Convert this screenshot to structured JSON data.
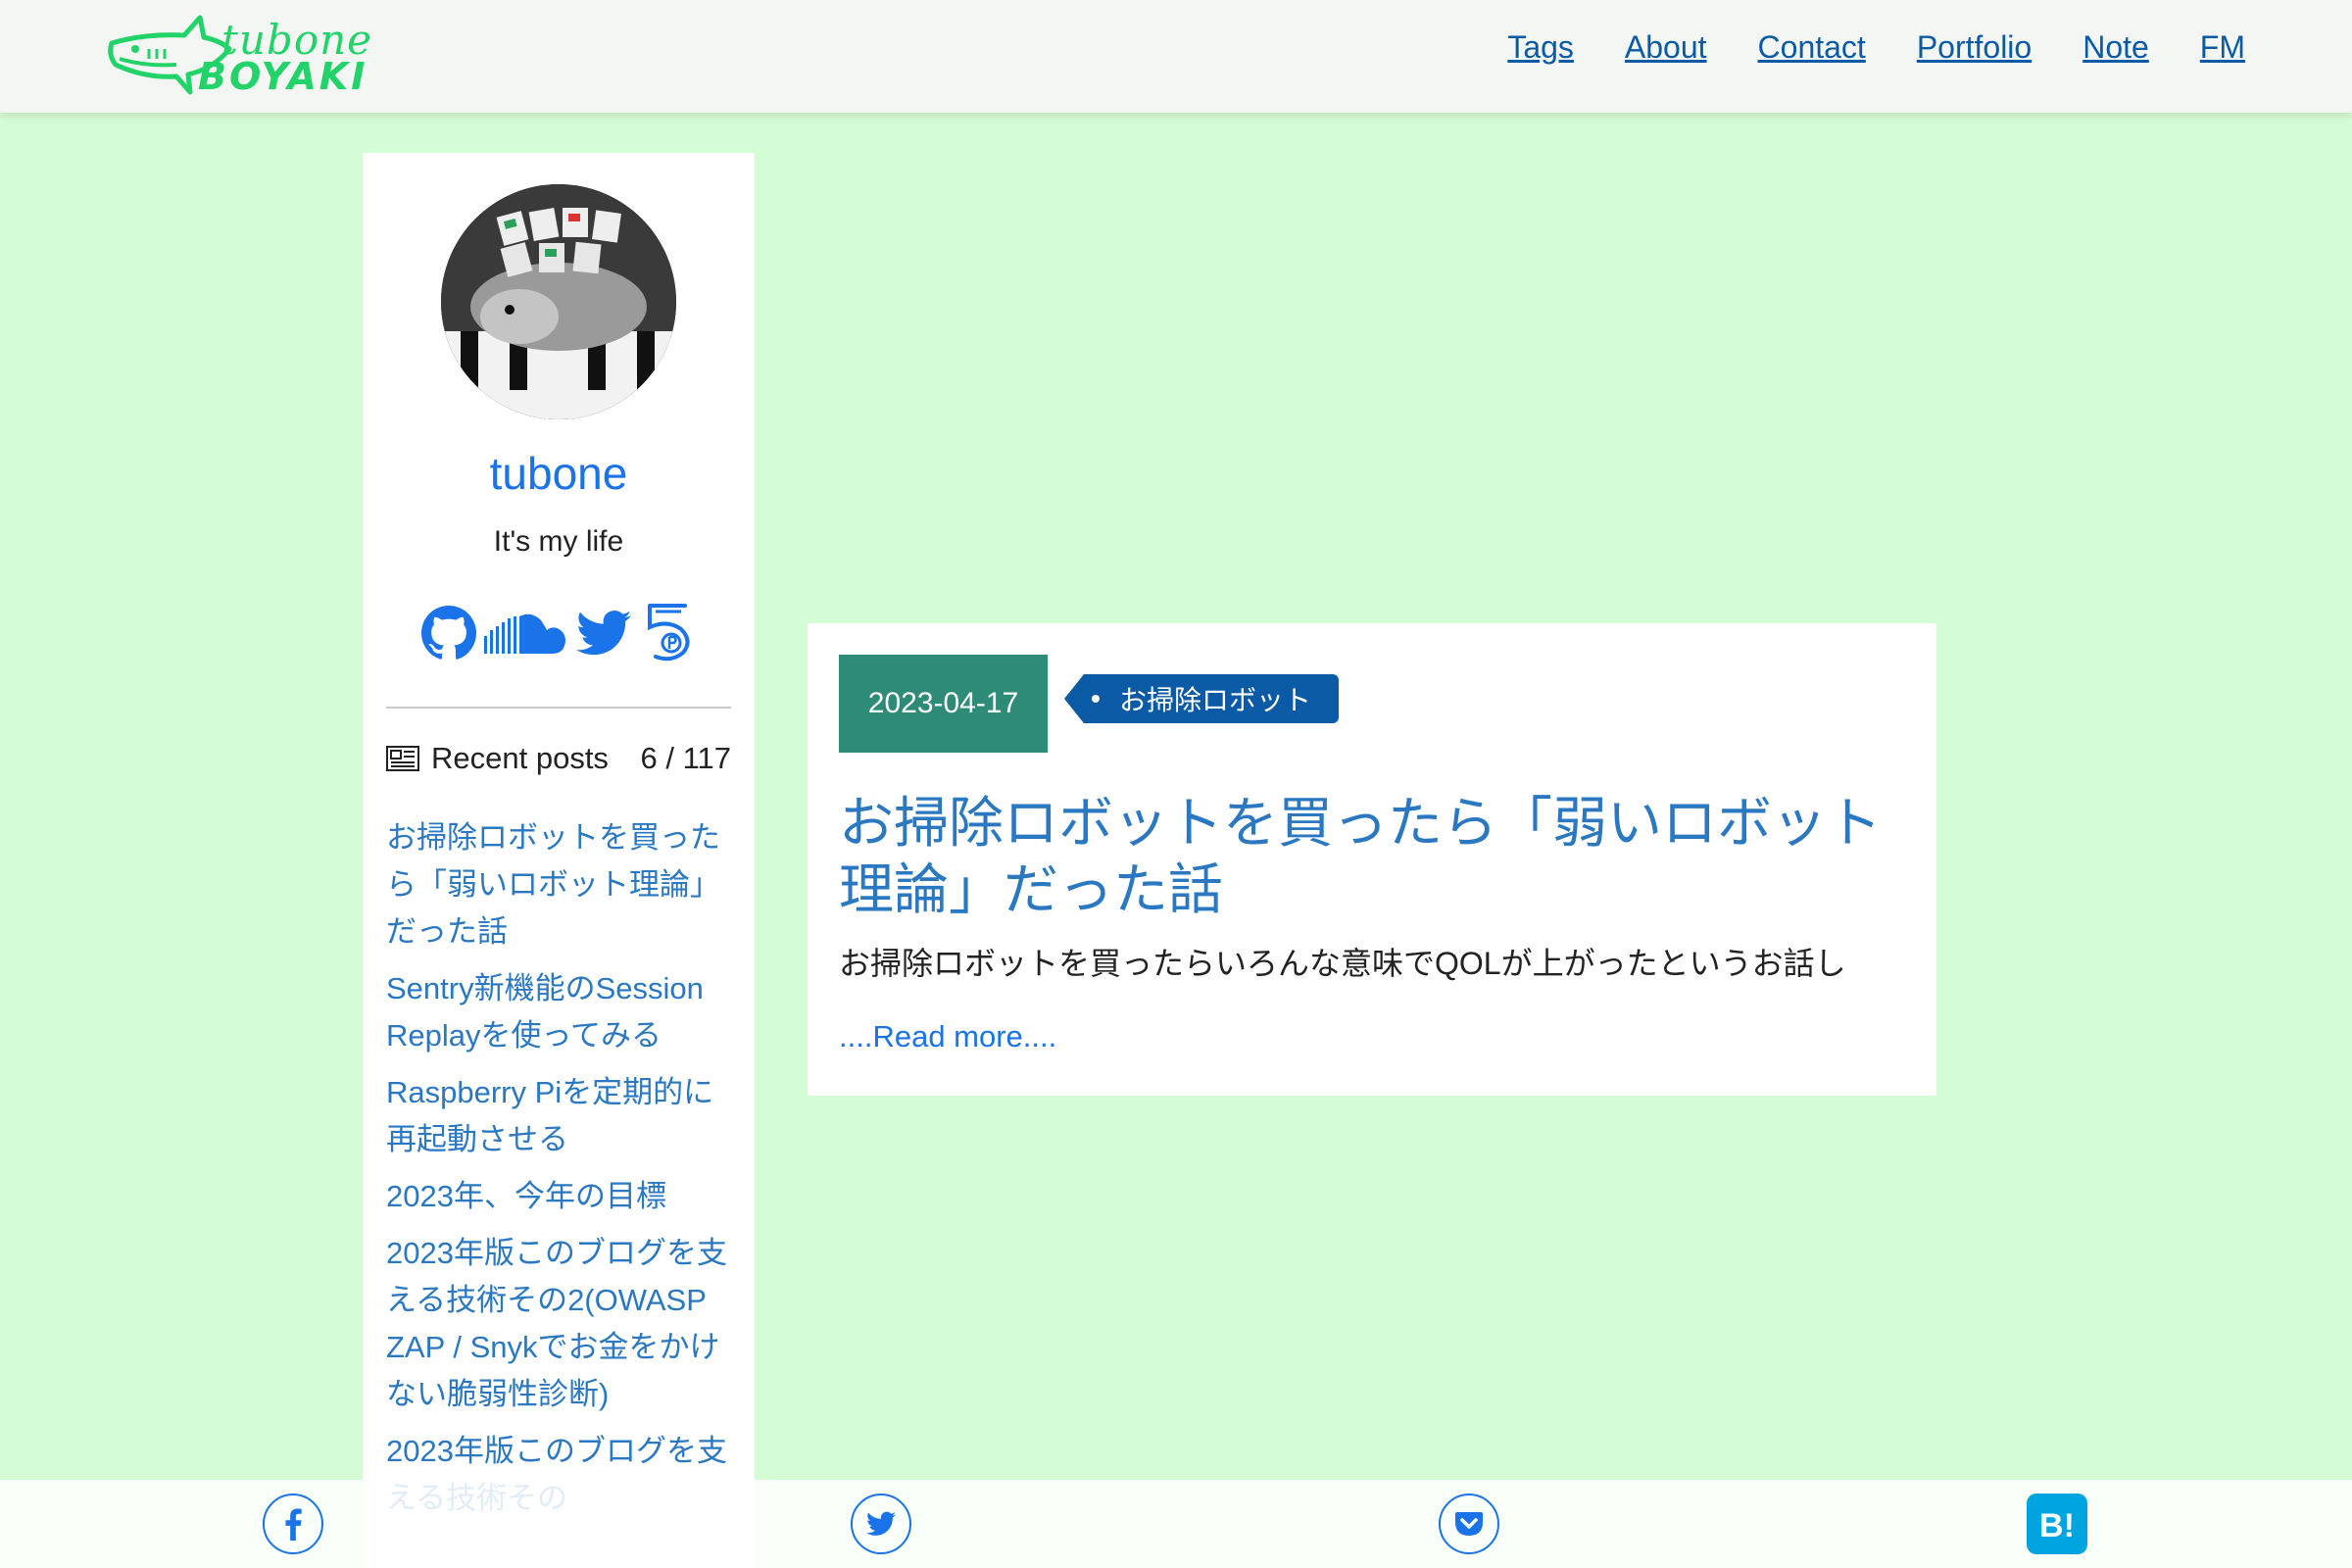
{
  "header": {
    "logo_line1": "tubone",
    "logo_line2": "BOYAKI",
    "nav": [
      "Tags",
      "About",
      "Contact",
      "Portfolio",
      "Note",
      "FM"
    ]
  },
  "sidebar": {
    "author_name": "tubone",
    "author_desc": "It's my life",
    "socials": [
      "github-icon",
      "soundcloud-icon",
      "twitter-icon",
      "fm-icon"
    ],
    "recent_label": "Recent posts",
    "recent_count": "6 / 117",
    "recent_posts": [
      "お掃除ロボットを買ったら「弱いロボット理論」だった話",
      "Sentry新機能のSession Replayを使ってみる",
      "Raspberry Piを定期的に再起動させる",
      "2023年、今年の目標",
      "2023年版このブログを支える技術その2(OWASP ZAP / Snykでお金をかけない脆弱性診断)",
      "2023年版このブログを支える技術その"
    ]
  },
  "post": {
    "date": "2023-04-17",
    "tag": "お掃除ロボット",
    "title": "お掃除ロボットを買ったら「弱いロボット理論」だった話",
    "summary": "お掃除ロボットを買ったらいろんな意味でQOLが上がったというお話し",
    "read_more": "....Read more...."
  },
  "share": [
    "facebook-icon",
    "twitter-icon",
    "pocket-icon",
    "hatena-bookmark-icon"
  ],
  "colors": {
    "background": "#d5fdd5",
    "brand": "#22d36a",
    "link": "#2b78c2",
    "date_badge": "#2e8b78",
    "tag": "#0b5aa6"
  }
}
